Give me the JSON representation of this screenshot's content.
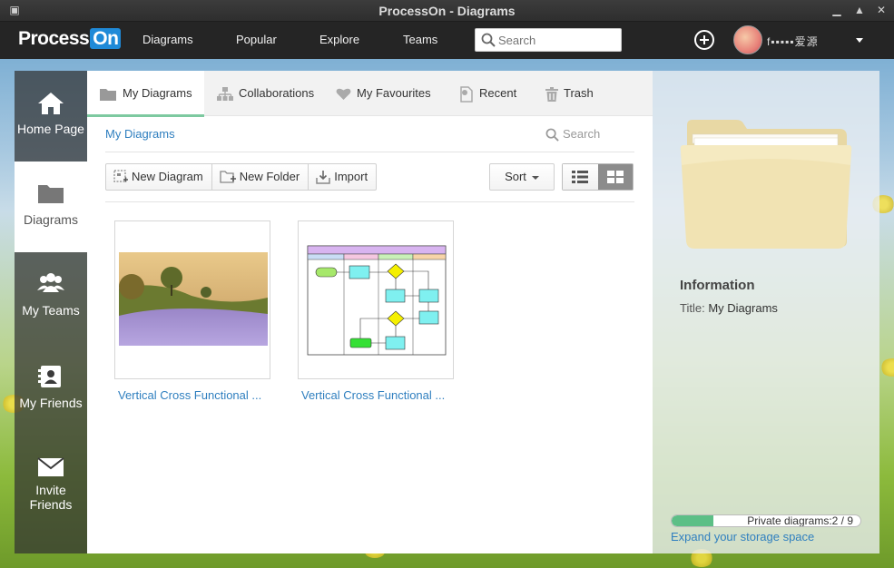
{
  "window": {
    "title": "ProcessOn - Diagrams"
  },
  "logo": {
    "part1": "Process",
    "part2": "On"
  },
  "nav": {
    "diagrams": "Diagrams",
    "popular": "Popular",
    "explore": "Explore",
    "teams": "Teams"
  },
  "search": {
    "placeholder": "Search"
  },
  "user": {
    "name": "f▪▪▪▪▪爱源"
  },
  "sidebar": {
    "items": [
      {
        "label": "Home Page",
        "icon": "home-icon"
      },
      {
        "label": "Diagrams",
        "icon": "folder-icon"
      },
      {
        "label": "My Teams",
        "icon": "team-icon"
      },
      {
        "label": "My Friends",
        "icon": "contacts-icon"
      },
      {
        "label": "Invite Friends",
        "icon": "envelope-icon"
      }
    ]
  },
  "tabs": [
    {
      "label": "My Diagrams",
      "icon": "folder-icon"
    },
    {
      "label": "Collaborations",
      "icon": "org-chart-icon"
    },
    {
      "label": "My Favourites",
      "icon": "heart-icon"
    },
    {
      "label": "Recent",
      "icon": "recent-file-icon"
    },
    {
      "label": "Trash",
      "icon": "trash-icon"
    }
  ],
  "breadcrumb": "My Diagrams",
  "inner_search": {
    "label": "Search"
  },
  "toolbar": {
    "new_diagram": "New Diagram",
    "new_folder": "New Folder",
    "import": "Import",
    "sort": "Sort"
  },
  "files": [
    {
      "name": "Vertical Cross Functional ...",
      "thumbnail": "landscape-photo"
    },
    {
      "name": "Vertical Cross Functional ...",
      "thumbnail": "swimlane-flowchart"
    }
  ],
  "info": {
    "heading": "Information",
    "title_label": "Title:",
    "title_value": "My Diagrams",
    "storage_text": "Private diagrams:2 / 9",
    "storage_fraction": 0.222,
    "expand_link": "Expand your storage space"
  },
  "colors": {
    "accent_blue": "#1f8ad8",
    "link": "#2f7fbf",
    "active_tab": "#7dc9a0",
    "storage": "#5cbf86"
  }
}
